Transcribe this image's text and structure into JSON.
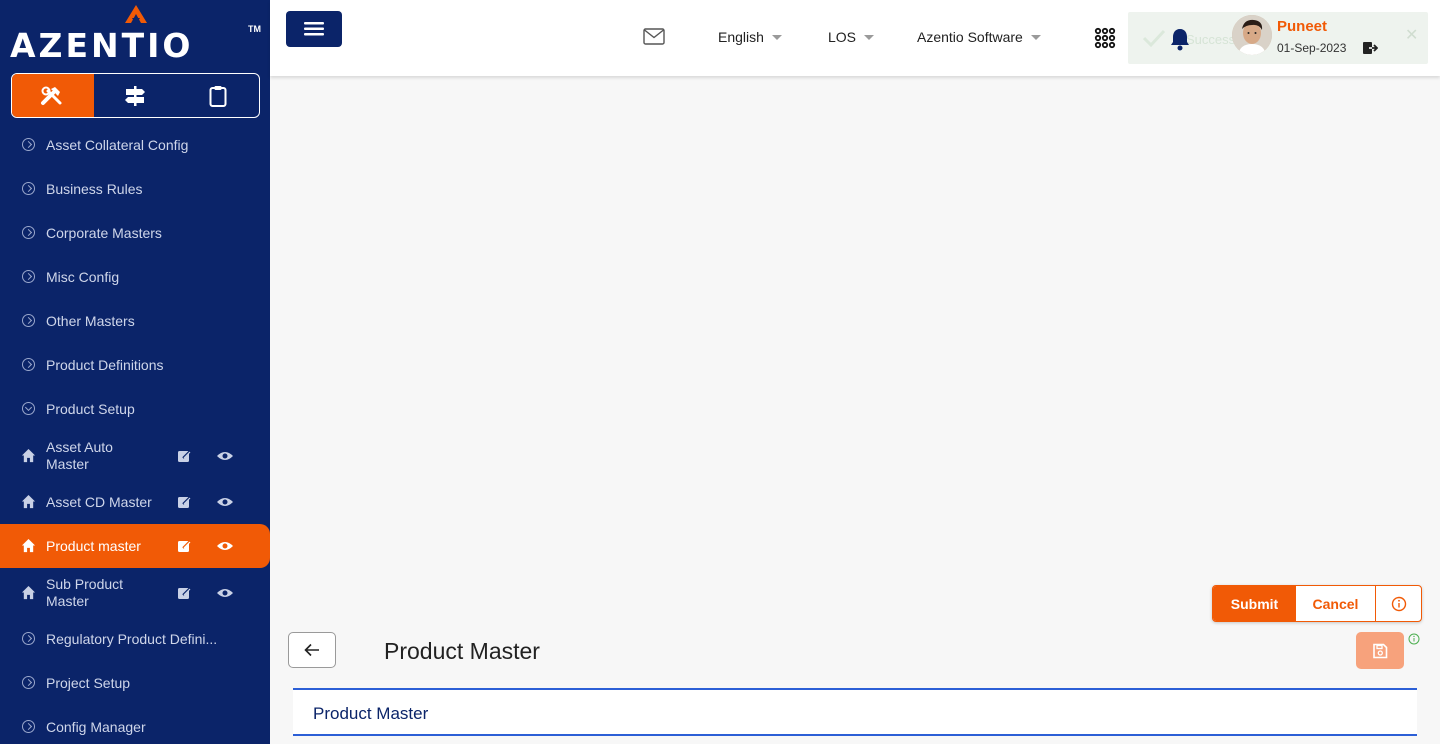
{
  "brand": {
    "name": "AZENTIO",
    "tm": "TM"
  },
  "sidebar": {
    "modes": [
      "tools-icon",
      "signpost-icon",
      "clipboard-icon"
    ],
    "items": [
      {
        "label": "Asset Collateral Config",
        "type": "group"
      },
      {
        "label": "Business Rules",
        "type": "group"
      },
      {
        "label": "Corporate Masters",
        "type": "group"
      },
      {
        "label": "Misc Config",
        "type": "group"
      },
      {
        "label": "Other Masters",
        "type": "group"
      },
      {
        "label": "Product Definitions",
        "type": "group"
      },
      {
        "label": "Product Setup",
        "type": "group-open"
      },
      {
        "label_line1": "Asset Auto",
        "label_line2": "Master",
        "type": "child"
      },
      {
        "label": "Asset CD Master",
        "type": "child"
      },
      {
        "label": "Product master",
        "type": "child",
        "selected": true
      },
      {
        "label_line1": "Sub Product",
        "label_line2": "Master",
        "type": "child"
      },
      {
        "label": "Regulatory Product Defini...",
        "type": "group"
      },
      {
        "label": "Project Setup",
        "type": "group"
      },
      {
        "label": "Config Manager",
        "type": "group"
      }
    ]
  },
  "header": {
    "language": "English",
    "module": "LOS",
    "company": "Azentio Software",
    "toast_text": "Success",
    "user_name": "Puneet",
    "date": "01-Sep-2023"
  },
  "actions": {
    "submit": "Submit",
    "cancel": "Cancel"
  },
  "page": {
    "title": "Product Master",
    "section_title": "Product Master"
  },
  "colors": {
    "navy": "#0b2469",
    "accent": "#f15a06",
    "section_border": "#2c5fd6"
  }
}
